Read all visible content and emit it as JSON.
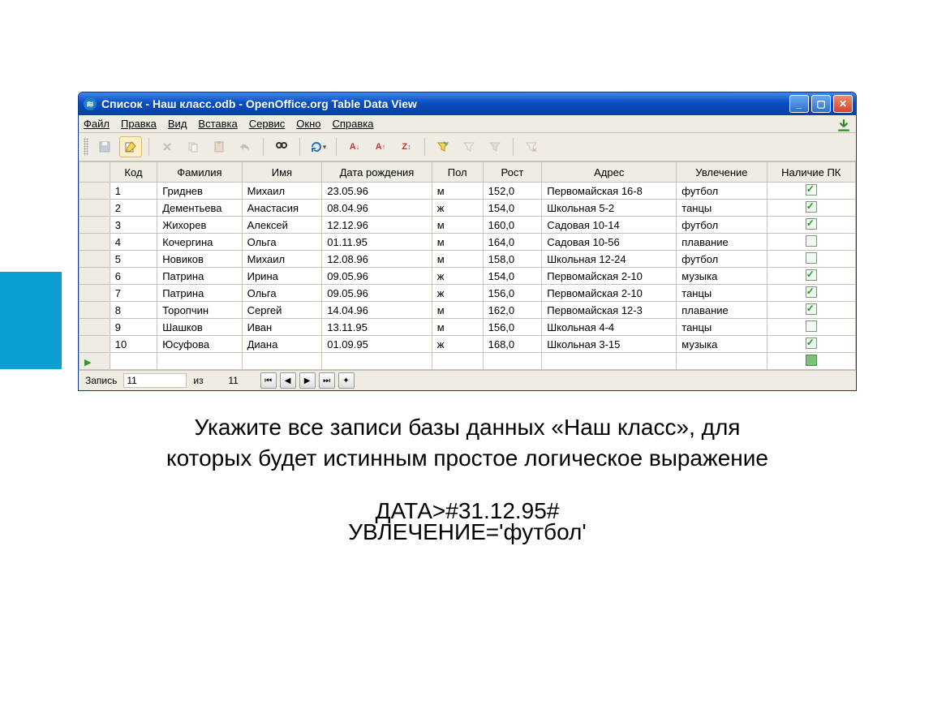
{
  "window": {
    "title": "Список  - Наш класс.odb - OpenOffice.org Table Data View"
  },
  "menu": {
    "items": [
      "Файл",
      "Правка",
      "Вид",
      "Вставка",
      "Сервис",
      "Окно",
      "Справка"
    ]
  },
  "table": {
    "headers": [
      "Код",
      "Фамилия",
      "Имя",
      "Дата рождения",
      "Пол",
      "Рост",
      "Адрес",
      "Увлечение",
      "Наличие ПК"
    ],
    "rows": [
      {
        "id": "1",
        "fam": "Гриднев",
        "name": "Михаил",
        "date": "23.05.96",
        "sex": "м",
        "height": "152,0",
        "addr": "Первомайская 16-8",
        "hobby": "футбол",
        "pc": true
      },
      {
        "id": "2",
        "fam": "Дементьева",
        "name": "Анастасия",
        "date": "08.04.96",
        "sex": "ж",
        "height": "154,0",
        "addr": "Школьная 5-2",
        "hobby": "танцы",
        "pc": true
      },
      {
        "id": "3",
        "fam": "Жихорев",
        "name": "Алексей",
        "date": "12.12.96",
        "sex": "м",
        "height": "160,0",
        "addr": "Садовая 10-14",
        "hobby": "футбол",
        "pc": true
      },
      {
        "id": "4",
        "fam": "Кочергина",
        "name": "Ольга",
        "date": "01.11.95",
        "sex": "м",
        "height": "164,0",
        "addr": "Садовая 10-56",
        "hobby": "плавание",
        "pc": false
      },
      {
        "id": "5",
        "fam": "Новиков",
        "name": "Михаил",
        "date": "12.08.96",
        "sex": "м",
        "height": "158,0",
        "addr": "Школьная 12-24",
        "hobby": "футбол",
        "pc": false
      },
      {
        "id": "6",
        "fam": "Патрина",
        "name": "Ирина",
        "date": "09.05.96",
        "sex": "ж",
        "height": "154,0",
        "addr": "Первомайская 2-10",
        "hobby": "музыка",
        "pc": true
      },
      {
        "id": "7",
        "fam": "Патрина",
        "name": "Ольга",
        "date": "09.05.96",
        "sex": "ж",
        "height": "156,0",
        "addr": "Первомайская 2-10",
        "hobby": "танцы",
        "pc": true
      },
      {
        "id": "8",
        "fam": "Торопчин",
        "name": "Сергей",
        "date": "14.04.96",
        "sex": "м",
        "height": "162,0",
        "addr": "Первомайская 12-3",
        "hobby": "плавание",
        "pc": true
      },
      {
        "id": "9",
        "fam": "Шашков",
        "name": "Иван",
        "date": "13.11.95",
        "sex": "м",
        "height": "156,0",
        "addr": "Школьная 4-4",
        "hobby": "танцы",
        "pc": false
      },
      {
        "id": "10",
        "fam": "Юсуфова",
        "name": "Диана",
        "date": "01.09.95",
        "sex": "ж",
        "height": "168,0",
        "addr": "Школьная 3-15",
        "hobby": "музыка",
        "pc": true
      }
    ]
  },
  "nav": {
    "label": "Запись",
    "current": "11",
    "of": "из",
    "total": "11"
  },
  "question": {
    "line1": "Укажите все записи базы данных «Наш класс», для",
    "line2": "которых будет истинным простое логическое выражение",
    "overlay1": "ДАТА>#31.12.95#",
    "overlay2": "УВЛЕЧЕНИЕ='футбол'"
  }
}
